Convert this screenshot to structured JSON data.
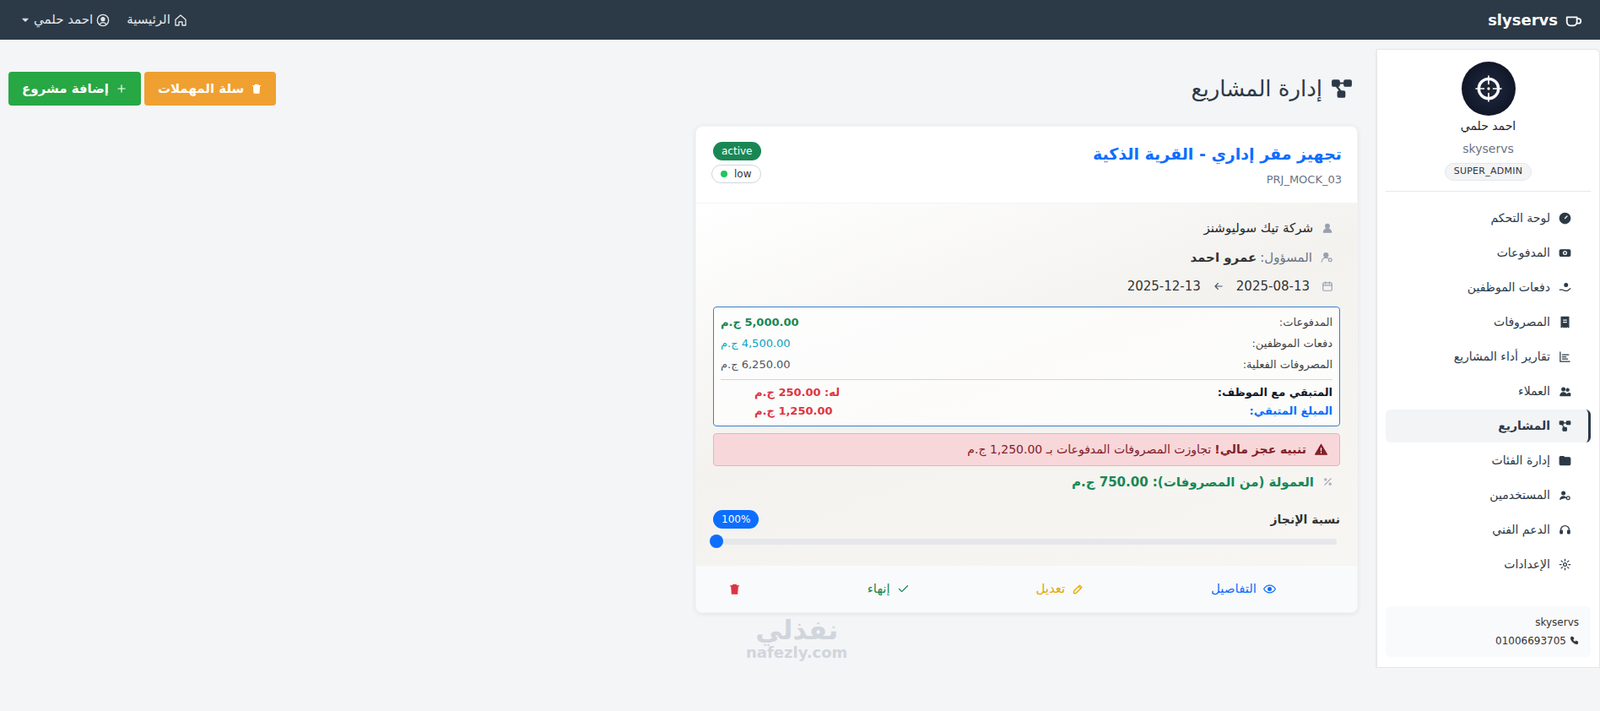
{
  "topbar": {
    "brand": "slyservs",
    "home": "الرئيسية",
    "user": "احمد حلمي"
  },
  "sidebar": {
    "name": "احمد حلمي",
    "company": "skyservs",
    "role": "SUPER_ADMIN",
    "items": [
      {
        "label": "لوحة التحكم",
        "selected": false
      },
      {
        "label": "المدفوعات",
        "selected": false
      },
      {
        "label": "دفعات الموظفين",
        "selected": false
      },
      {
        "label": "المصروفات",
        "selected": false
      },
      {
        "label": "تقارير أداء المشاريع",
        "selected": false
      },
      {
        "label": "العملاء",
        "selected": false
      },
      {
        "label": "المشاريع",
        "selected": true
      },
      {
        "label": "إدارة الفئات",
        "selected": false
      },
      {
        "label": "المستخدمين",
        "selected": false
      },
      {
        "label": "الدعم الفني",
        "selected": false
      },
      {
        "label": "الإعدادات",
        "selected": false
      }
    ],
    "footer": {
      "company": "skyservs",
      "phone": "01006693705"
    }
  },
  "page": {
    "title": "إدارة المشاريع",
    "buttons": [
      {
        "label": "سلة المهملات",
        "kind": "trash"
      },
      {
        "label": "إضافة مشروع",
        "kind": "add"
      }
    ]
  },
  "project": {
    "title": "تجهيز مقر إداري - القرية الذكية",
    "code": "PRJ_MOCK_03",
    "status": "active",
    "priority": {
      "label": "low",
      "color": "#22c55e"
    },
    "client": "شركة تيك سوليوشنز",
    "manager": {
      "label": "المسؤول:",
      "value": "عمرو احمد"
    },
    "dates": {
      "start": "2025-08-13",
      "end": "2025-12-13"
    },
    "finance": {
      "rows": [
        {
          "label": "المدفوعات:",
          "value": "5,000.00 ج.م",
          "color": "#198754"
        },
        {
          "label": "دفعات الموظفين:",
          "value": "4,500.00 ج.م",
          "color": "#0aa2c0"
        },
        {
          "label": "المصروفات الفعلية:",
          "value": "6,250.00 ج.م",
          "color": "#4b5563"
        }
      ],
      "totals": [
        {
          "label": "المتبقي مع الموظف:",
          "value": "له: 250.00 ج.م",
          "color": "#dc3545",
          "label_color": "#111827"
        },
        {
          "label": "المبلغ المتبقي:",
          "value": "1,250.00 ج.م",
          "color": "#dc3545",
          "label_color": "#0d6efd"
        }
      ]
    },
    "alert": {
      "title": "تنبيه عجز مالي!",
      "message": "تجاوزت المصروفات المدفوعات بـ 1,250.00 ج.م"
    },
    "commission": "العمولة (من المصروفات): 750.00 ج.م",
    "progress": {
      "label": "نسبة الإنجاز",
      "reading": "100%",
      "level": 1
    },
    "actions": [
      {
        "label": "التفاصيل",
        "kind": "details"
      },
      {
        "label": "تعديل",
        "kind": "edit"
      },
      {
        "label": "إنهاء",
        "kind": "finish"
      },
      {
        "label": "",
        "kind": "delete"
      }
    ]
  },
  "watermark": {
    "arabic": "نفذلي",
    "latin": "nafezly.com"
  }
}
